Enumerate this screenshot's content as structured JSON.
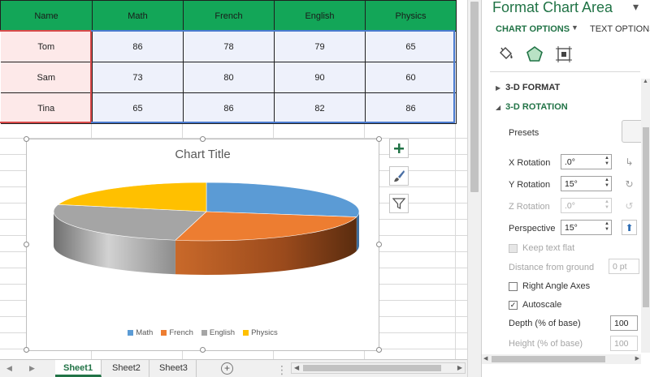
{
  "table": {
    "headers": [
      "Name",
      "Math",
      "French",
      "English",
      "Physics"
    ],
    "rows": [
      {
        "name": "Tom",
        "values": [
          "86",
          "78",
          "79",
          "65"
        ]
      },
      {
        "name": "Sam",
        "values": [
          "73",
          "80",
          "90",
          "60"
        ]
      },
      {
        "name": "Tina",
        "values": [
          "65",
          "86",
          "82",
          "86"
        ]
      }
    ]
  },
  "chart_data": {
    "type": "pie",
    "title": "Chart Title",
    "labels": [
      "Math",
      "French",
      "English",
      "Physics"
    ],
    "values": [
      86,
      78,
      79,
      65
    ],
    "colors": [
      "#5b9bd5",
      "#ed7d31",
      "#a5a5a5",
      "#ffc000"
    ],
    "legend_position": "bottom",
    "three_d": true
  },
  "sheet_tabs": [
    "Sheet1",
    "Sheet2",
    "Sheet3"
  ],
  "active_sheet": "Sheet1",
  "pane": {
    "title": "Format Chart Area",
    "tab_chart_options": "CHART OPTIONS",
    "tab_text_options": "TEXT OPTIONS",
    "section_3d_format": "3-D FORMAT",
    "section_3d_rotation": "3-D ROTATION",
    "presets_label": "Presets",
    "x_rotation_label": "X Rotation",
    "x_rotation_value": ".0°",
    "y_rotation_label": "Y Rotation",
    "y_rotation_value": "15°",
    "z_rotation_label": "Z Rotation",
    "z_rotation_value": ".0°",
    "perspective_label": "Perspective",
    "perspective_value": "15°",
    "keep_text_flat_label": "Keep text flat",
    "distance_label": "Distance from ground",
    "distance_value": "0 pt",
    "right_angle_label": "Right Angle Axes",
    "autoscale_label": "Autoscale",
    "depth_label": "Depth (% of base)",
    "depth_value": "100",
    "height_label": "Height (% of base)",
    "height_value": "100"
  }
}
